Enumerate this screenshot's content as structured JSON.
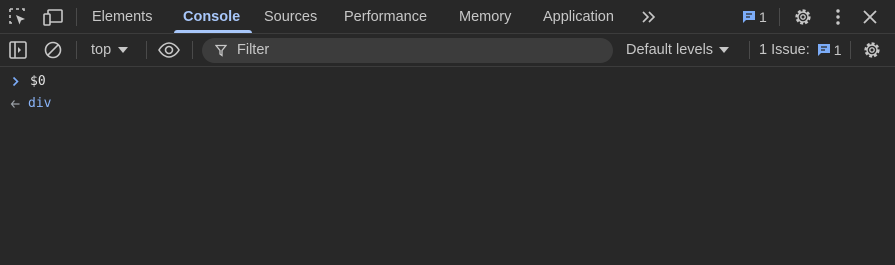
{
  "tabs": [
    {
      "label": "Elements"
    },
    {
      "label": "Console"
    },
    {
      "label": "Sources"
    },
    {
      "label": "Performance"
    },
    {
      "label": "Memory"
    },
    {
      "label": "Application"
    }
  ],
  "header": {
    "message_count": "1"
  },
  "toolbar": {
    "context": "top",
    "filter_placeholder": "Filter",
    "levels": "Default levels",
    "issues_label": "1 Issue:",
    "issues_count": "1"
  },
  "console": {
    "entries": [
      {
        "type": "input",
        "text": "$0"
      },
      {
        "type": "result",
        "text": "div"
      }
    ]
  },
  "colors": {
    "background": "#282828",
    "accent": "#a8c7fa",
    "text": "#c7c7c7",
    "result": "#8ab4f8"
  }
}
